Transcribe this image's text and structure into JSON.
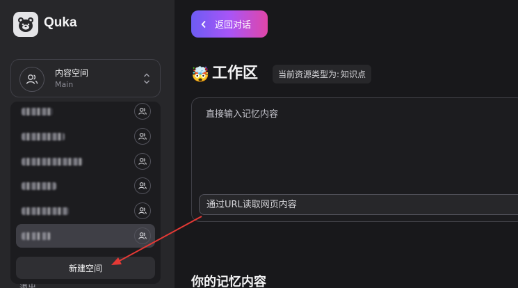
{
  "app": {
    "name": "Quka",
    "logo_icon": "bear-icon"
  },
  "space_selector": {
    "name": "内容空间",
    "subtitle": "Main"
  },
  "spaces": [
    {
      "name_width": 45,
      "active": false
    },
    {
      "name_width": 62,
      "active": false
    },
    {
      "name_width": 88,
      "active": false
    },
    {
      "name_width": 50,
      "active": false
    },
    {
      "name_width": 68,
      "active": false
    },
    {
      "name_width": 42,
      "active": true
    }
  ],
  "dropdown": {
    "new_space_label": "新建空间"
  },
  "sidebar_bottom_peek": "退出",
  "header": {
    "back_label": "返回对话"
  },
  "workspace": {
    "emoji": "🤯",
    "title": "工作区",
    "type_label": "当前资源类型为:",
    "type_value": "知识点"
  },
  "editor": {
    "placeholder": "直接输入记忆内容",
    "url_placeholder": "通过URL读取网页内容"
  },
  "memories": {
    "title": "你的记忆内容"
  },
  "colors": {
    "accent_start": "#6d5cf2",
    "accent_end": "#e046a8",
    "annotation_arrow": "#e53935"
  }
}
